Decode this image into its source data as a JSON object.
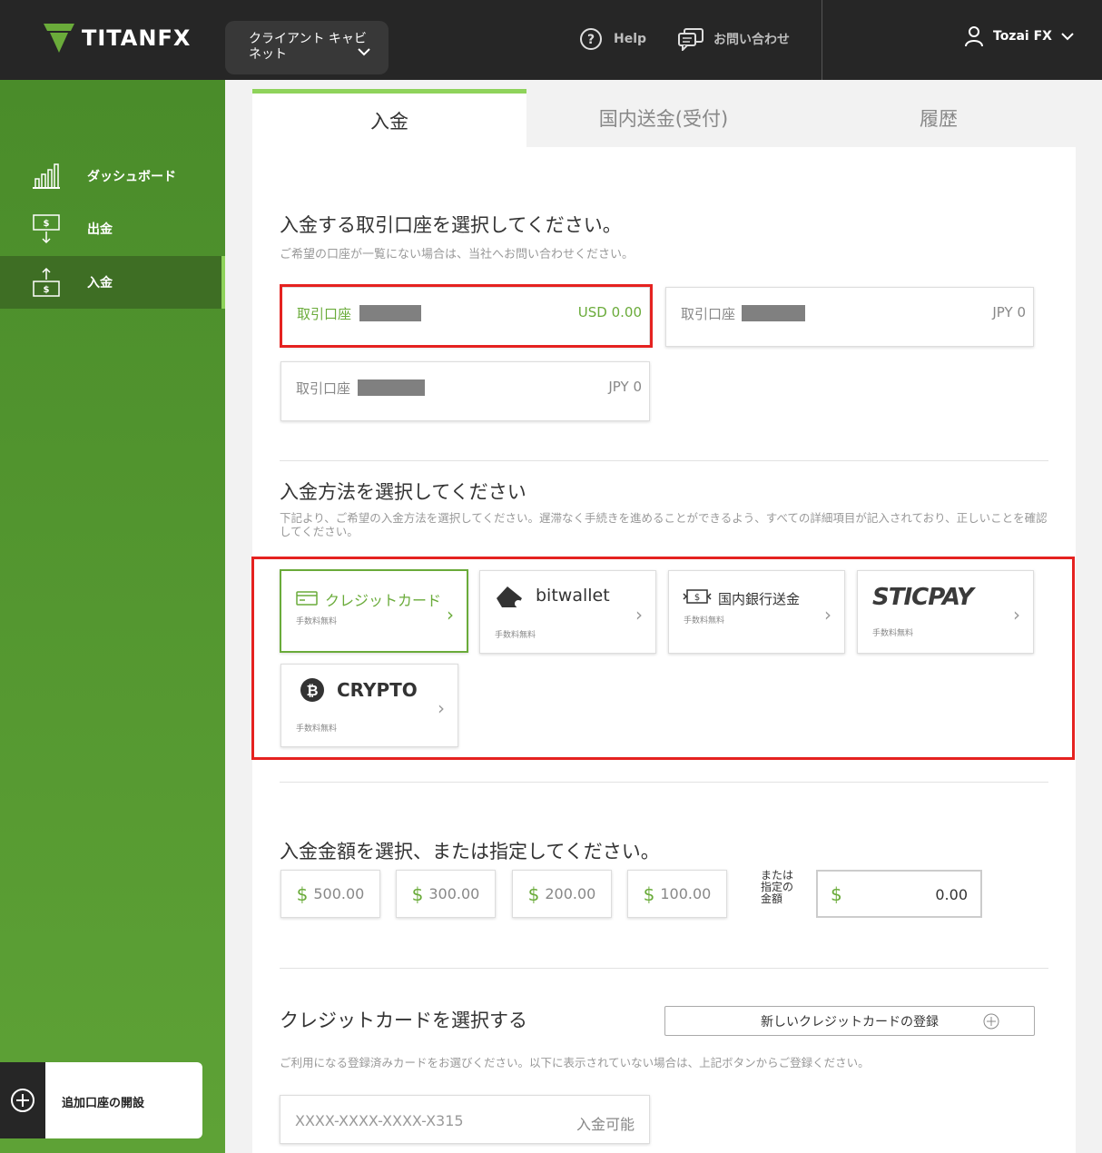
{
  "brand": {
    "logo_text": "TITANFX",
    "accent": "#6aab3a",
    "highlight": "#e52220"
  },
  "header": {
    "cabinet_label": "クライアント キャビネット",
    "help_label": "Help",
    "contact_label": "お問い合わせ",
    "user_name": "Tozai FX"
  },
  "sidebar": {
    "items": [
      {
        "label": "ダッシュボード",
        "icon": "bar-chart-icon"
      },
      {
        "label": "出金",
        "icon": "withdraw-icon"
      },
      {
        "label": "入金",
        "icon": "deposit-icon"
      }
    ],
    "open_account_label": "追加口座の開設"
  },
  "tabs": [
    {
      "label": "入金"
    },
    {
      "label": "国内送金(受付)"
    },
    {
      "label": "履歴"
    }
  ],
  "account_section": {
    "title": "入金する取引口座を選択してください。",
    "subtitle": "ご希望の口座が一覧にない場合は、当社へお問い合わせください。",
    "accounts": [
      {
        "name": "取引口座",
        "balance": "USD 0.00"
      },
      {
        "name": "取引口座",
        "balance": "JPY 0"
      },
      {
        "name": "取引口座",
        "balance": "JPY 0"
      }
    ]
  },
  "method_section": {
    "title": "入金方法を選択してください",
    "subtitle": "下記より、ご希望の入金方法を選択してください。遅滞なく手続きを進めることができるよう、すべての詳細項目が記入されており、正しいことを確認してください。",
    "methods": [
      {
        "label": "クレジットカード",
        "fee": "手数料無料"
      },
      {
        "label": "bitwallet",
        "fee": "手数料無料"
      },
      {
        "label": "国内銀行送金",
        "fee": "手数料無料"
      },
      {
        "label": "STICPAY",
        "fee": "手数料無料"
      },
      {
        "label": "CRYPTO",
        "fee": "手数料無料"
      }
    ]
  },
  "amount_section": {
    "title": "入金金額を選択、または指定してください。",
    "currency_symbol": "$",
    "presets": [
      "500.00",
      "300.00",
      "200.00",
      "100.00"
    ],
    "or_label": "または指定の金額",
    "custom_value": "0.00"
  },
  "card_section": {
    "title": "クレジットカードを選択する",
    "new_card_label": "新しいクレジットカードの登録",
    "subtitle": "ご利用になる登録済みカードをお選びください。以下に表示されていない場合は、上記ボタンからご登録ください。",
    "cards": [
      {
        "number": "XXXX-XXXX-XXXX-X315",
        "status": "入金可能"
      }
    ]
  }
}
